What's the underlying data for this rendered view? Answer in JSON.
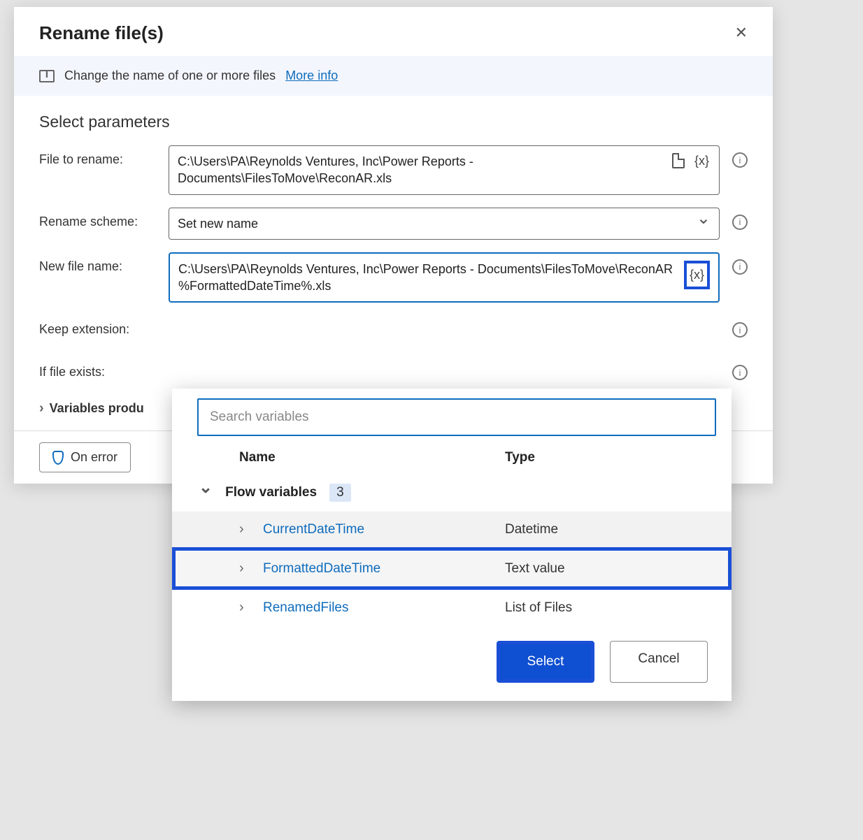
{
  "dialog": {
    "title": "Rename file(s)",
    "description": "Change the name of one or more files",
    "more_info": "More info",
    "section_title": "Select parameters",
    "labels": {
      "file_to_rename": "File to rename:",
      "rename_scheme": "Rename scheme:",
      "new_file_name": "New file name:",
      "keep_extension": "Keep extension:",
      "if_file_exists": "If file exists:"
    },
    "values": {
      "file_to_rename": "C:\\Users\\PA\\Reynolds Ventures, Inc\\Power Reports - Documents\\FilesToMove\\ReconAR.xls",
      "rename_scheme": "Set new name",
      "new_file_name": "C:\\Users\\PA\\Reynolds Ventures, Inc\\Power Reports - Documents\\FilesToMove\\ReconAR %FormattedDateTime%.xls"
    },
    "variables_produced": "Variables produ",
    "on_error": "On error"
  },
  "picker": {
    "search_placeholder": "Search variables",
    "col_name": "Name",
    "col_type": "Type",
    "group": {
      "label": "Flow variables",
      "count": "3"
    },
    "vars": [
      {
        "name": "CurrentDateTime",
        "type": "Datetime"
      },
      {
        "name": "FormattedDateTime",
        "type": "Text value"
      },
      {
        "name": "RenamedFiles",
        "type": "List of Files"
      }
    ],
    "select": "Select",
    "cancel": "Cancel"
  }
}
